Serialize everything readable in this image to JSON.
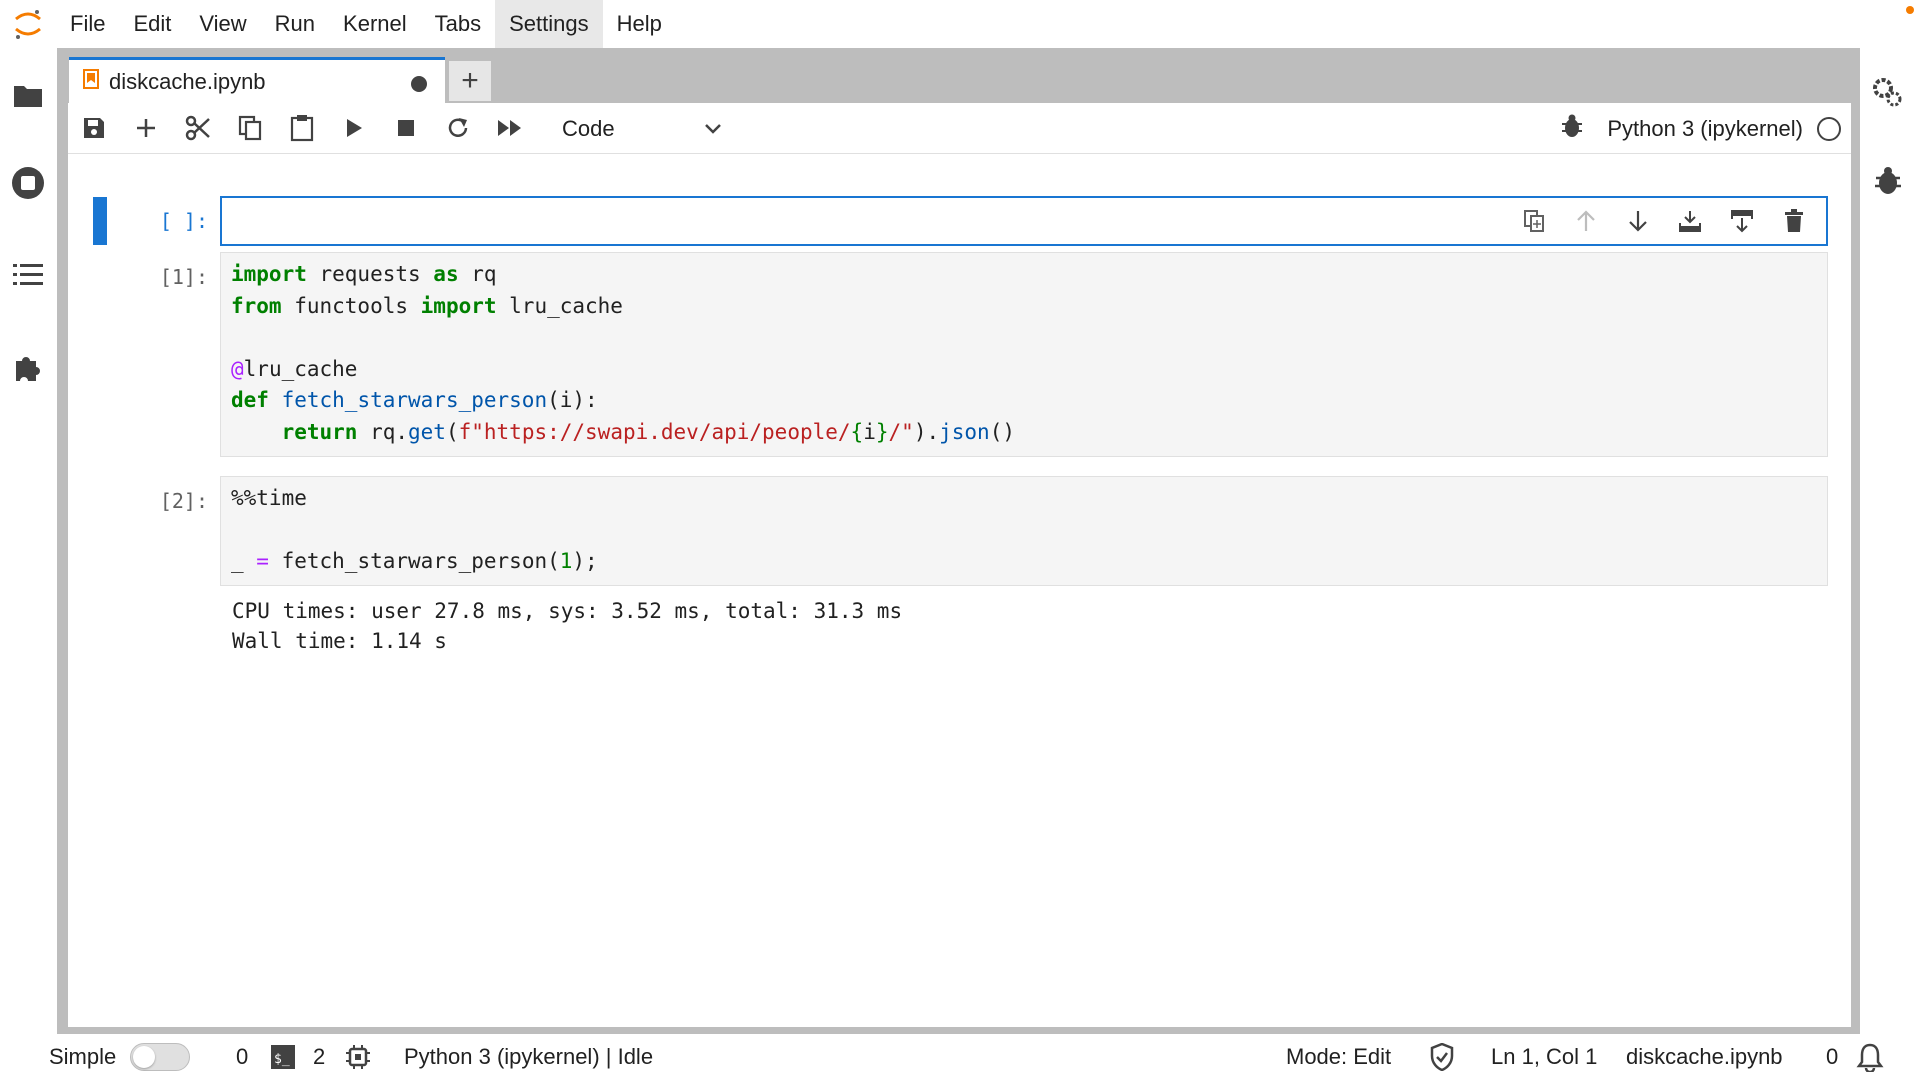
{
  "menu": [
    "File",
    "Edit",
    "View",
    "Run",
    "Kernel",
    "Tabs",
    "Settings",
    "Help"
  ],
  "active_menu": "Settings",
  "tab": {
    "title": "diskcache.ipynb",
    "new_tab_label": "+"
  },
  "toolbar": {
    "cell_type": "Code",
    "kernel": "Python 3 (ipykernel)"
  },
  "cells": {
    "c0": {
      "prompt": "[ ]:"
    },
    "c1": {
      "prompt": "[1]:"
    },
    "c2": {
      "prompt": "[2]:"
    }
  },
  "code": {
    "c1_l1_kw1": "import",
    "c1_l1_t1": " requests ",
    "c1_l1_kw2": "as",
    "c1_l1_t2": " rq",
    "c1_l2_kw1": "from",
    "c1_l2_t1": " functools ",
    "c1_l2_kw2": "import",
    "c1_l2_t2": " lru_cache",
    "c1_l4_at": "@",
    "c1_l4_t": "lru_cache",
    "c1_l5_kw": "def",
    "c1_l5_fn": "fetch_starwars_person",
    "c1_l5_t": "(i):",
    "c1_l6_ind": "    ",
    "c1_l6_kw": "return",
    "c1_l6_t1": " rq.",
    "c1_l6_get": "get",
    "c1_l6_t2": "(",
    "c1_l6_s1": "f\"https://swapi.dev/api/people/",
    "c1_l6_br": "{",
    "c1_l6_i": "i",
    "c1_l6_br2": "}",
    "c1_l6_s2": "/\"",
    "c1_l6_t3": ").",
    "c1_l6_json": "json",
    "c1_l6_t4": "()",
    "c2_l1": "%%time",
    "c2_l3_t1": "_ ",
    "c2_l3_eq": "=",
    "c2_l3_t2": " fetch_starwars_person(",
    "c2_l3_n": "1",
    "c2_l3_t3": ");"
  },
  "output": {
    "line1": "CPU times: user 27.8 ms, sys: 3.52 ms, total: 31.3 ms",
    "line2": "Wall time: 1.14 s"
  },
  "status": {
    "mode_label": "Simple",
    "terminals_count": "0",
    "kernels_count": "2",
    "kernel_status": "Python 3 (ipykernel) | Idle",
    "mode": "Mode: Edit",
    "position": "Ln 1, Col 1",
    "filename": "diskcache.ipynb",
    "notifications": "0"
  },
  "colors": {
    "accent": "#1976d2",
    "brand": "#f57c00"
  },
  "icons": [
    "jupyter-logo-icon",
    "folder-icon",
    "running-icon",
    "toc-icon",
    "extension-icon",
    "property-inspector-icon",
    "debugger-icon",
    "save-icon",
    "add-icon",
    "cut-icon",
    "copy-icon",
    "paste-icon",
    "run-icon",
    "stop-icon",
    "restart-icon",
    "fast-forward-icon",
    "bug-icon",
    "bell-icon"
  ]
}
